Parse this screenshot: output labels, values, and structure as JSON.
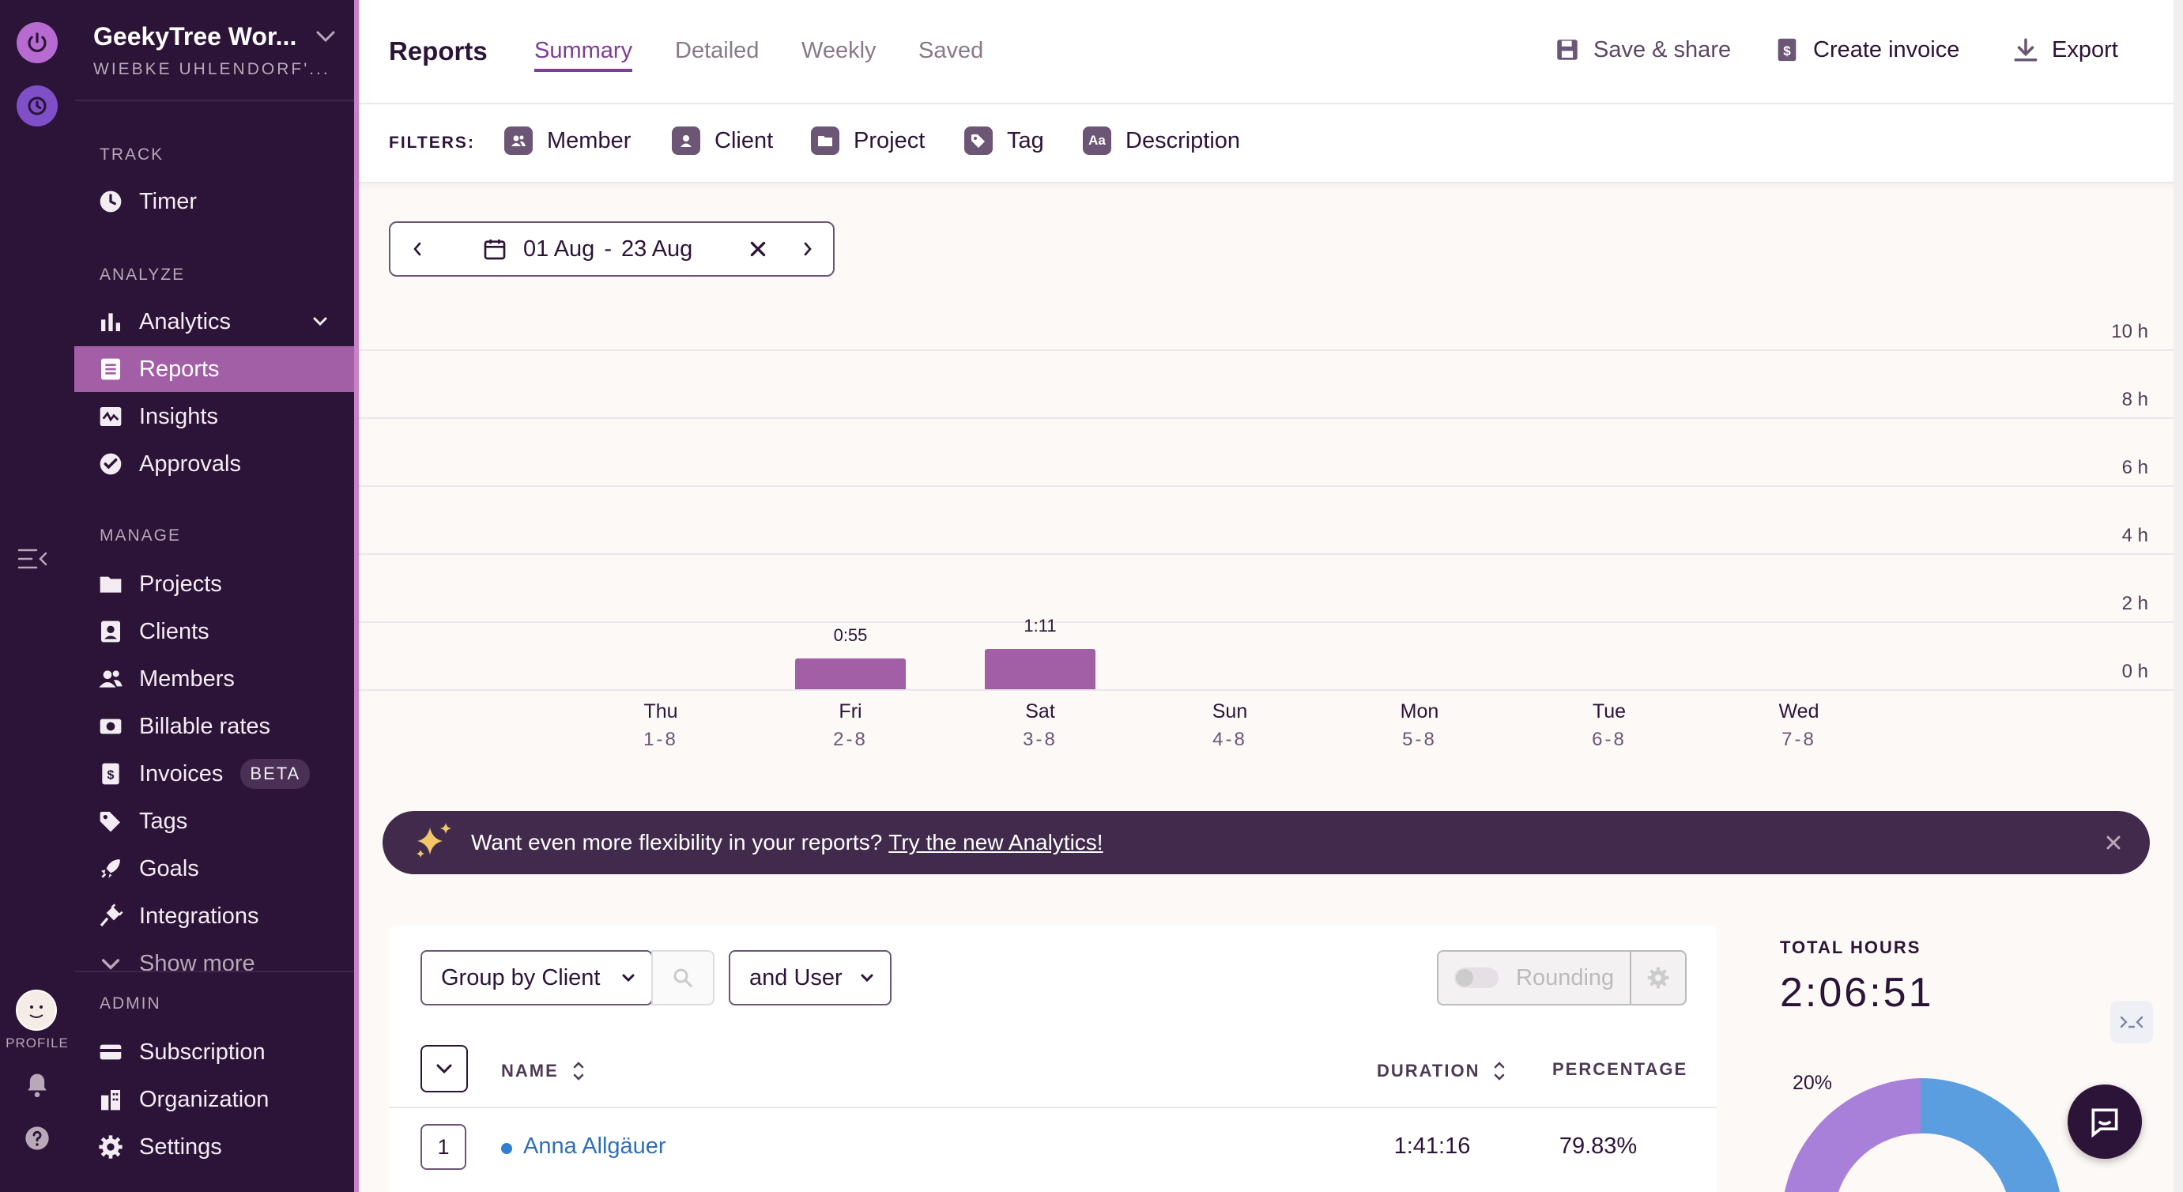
{
  "workspace": {
    "title": "GeekyTree Wor...",
    "subtitle": "WIEBKE UHLENDORF'..."
  },
  "rail": {
    "profile_label": "PROFILE"
  },
  "sidebar": {
    "sections": {
      "track": "TRACK",
      "analyze": "ANALYZE",
      "manage": "MANAGE",
      "admin": "ADMIN"
    },
    "items": {
      "timer": "Timer",
      "analytics": "Analytics",
      "reports": "Reports",
      "insights": "Insights",
      "approvals": "Approvals",
      "projects": "Projects",
      "clients": "Clients",
      "members": "Members",
      "billable_rates": "Billable rates",
      "invoices": "Invoices",
      "invoices_badge": "BETA",
      "tags": "Tags",
      "goals": "Goals",
      "integrations": "Integrations",
      "show_more": "Show more",
      "subscription": "Subscription",
      "organization": "Organization",
      "settings": "Settings"
    }
  },
  "header": {
    "title": "Reports",
    "tabs": {
      "summary": "Summary",
      "detailed": "Detailed",
      "weekly": "Weekly",
      "saved": "Saved"
    },
    "actions": {
      "save_share": "Save & share",
      "create_invoice": "Create invoice",
      "export": "Export"
    }
  },
  "filters": {
    "label": "FILTERS:",
    "member": "Member",
    "client": "Client",
    "project": "Project",
    "tag": "Tag",
    "description": "Description",
    "description_icon_text": "Aa"
  },
  "date_range": {
    "start": "01 Aug",
    "separator": "-",
    "end": "23 Aug"
  },
  "chart_data": {
    "type": "bar",
    "categories": [
      "Thu",
      "Fri",
      "Sat",
      "Sun",
      "Mon",
      "Tue",
      "Wed"
    ],
    "dates": [
      "1-8",
      "2-8",
      "3-8",
      "4-8",
      "5-8",
      "6-8",
      "7-8"
    ],
    "values": [
      0,
      0.9167,
      1.1833
    ],
    "data_labels": [
      "",
      "0:55",
      "1:11",
      "",
      "",
      "",
      ""
    ],
    "yticks": [
      "10 h",
      "8 h",
      "6 h",
      "4 h",
      "2 h",
      "0 h"
    ],
    "ylim": [
      0,
      10
    ],
    "grid": true,
    "colors": {
      "bar": "#a35fa6"
    }
  },
  "promo": {
    "text": "Want even more flexibility in your reports?",
    "link": "Try the new Analytics!"
  },
  "table": {
    "group_by": "Group by Client",
    "sub_group": "and User",
    "rounding": "Rounding",
    "columns": {
      "name": "NAME",
      "duration": "DURATION",
      "percentage": "PERCENTAGE"
    },
    "rows": [
      {
        "index": "1",
        "name": "Anna Allgäuer",
        "duration": "1:41:16",
        "percentage": "79.83%"
      }
    ]
  },
  "summary": {
    "total_label": "TOTAL HOURS",
    "total_value": "2:06:51",
    "donut_label": "20%"
  },
  "colors": {
    "sidebar_bg": "#2c1338",
    "accent": "#a35fa6",
    "tab_active": "#7e3d96",
    "promo_bg": "#412a4c",
    "donut_blue": "#5b9ee0",
    "donut_purple": "#a87fd9"
  }
}
